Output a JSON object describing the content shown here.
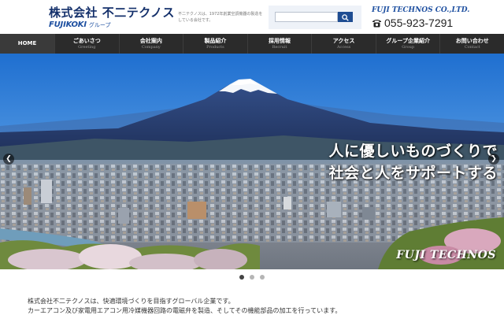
{
  "header": {
    "logo_main": "株式会社 不二テクノス",
    "logo_brand": "FUJIKOKI",
    "logo_group": "グループ",
    "tagline": "不二テクノスは、1972年創業空調機器の製造をしている会社です。",
    "search": {
      "value": "",
      "placeholder": ""
    },
    "company_en": "FUJI TECHNOS CO.,LTD.",
    "phone": "055-923-7291"
  },
  "nav": {
    "items": [
      {
        "label": "HOME",
        "sub": ""
      },
      {
        "label": "ごあいさつ",
        "sub": "Greeting"
      },
      {
        "label": "会社案内",
        "sub": "Company"
      },
      {
        "label": "製品紹介",
        "sub": "Products"
      },
      {
        "label": "採用情報",
        "sub": "Recruit"
      },
      {
        "label": "アクセス",
        "sub": "Access"
      },
      {
        "label": "グループ企業紹介",
        "sub": "Group"
      },
      {
        "label": "お問い合わせ",
        "sub": "Contact"
      }
    ]
  },
  "hero": {
    "line1": "人に優しいものづくりで",
    "line2": "社会と人をサポートする",
    "brand": "FUJI TECHNOS",
    "prev_icon": "chevron-left-icon",
    "next_icon": "chevron-right-icon"
  },
  "slider": {
    "slide_count": 3,
    "active_index": 0
  },
  "intro": {
    "line1": "株式会社不二テクノスは、快適環境づくりを目指すグローバル企業です。",
    "line2": "カーエアコン及び家電用エアコン用冷媒機器回路の電磁弁を製造、そしてその機能部品の加工を行っています。"
  },
  "colors": {
    "brand_blue": "#14306b",
    "nav_bg": "#2b2b2b",
    "search_button": "#1f4d92"
  }
}
